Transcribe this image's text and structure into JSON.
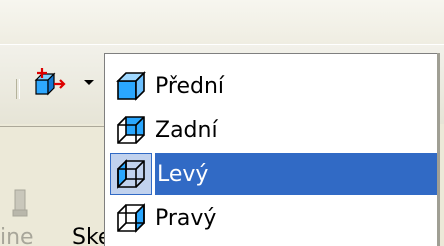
{
  "toolbar": {
    "view_tool_icon": "view-cube-orbit-icon",
    "dropdown_icon": "dropdown-arrow-icon"
  },
  "view_menu": {
    "items": [
      {
        "label": "Přední",
        "icon": "front-view-cube-icon",
        "selected": false
      },
      {
        "label": "Zadní",
        "icon": "back-view-cube-icon",
        "selected": false
      },
      {
        "label": "Levý",
        "icon": "left-view-cube-icon",
        "selected": true
      },
      {
        "label": "Pravý",
        "icon": "right-view-cube-icon",
        "selected": false
      }
    ]
  },
  "background": {
    "partial_text_left": "ine",
    "partial_text_right": "Ske"
  },
  "colors": {
    "selection": "#316ac5",
    "menu_bg": "#ffffff",
    "face_bg": "#ece9d8",
    "cube_blue": "#1e90ff"
  }
}
